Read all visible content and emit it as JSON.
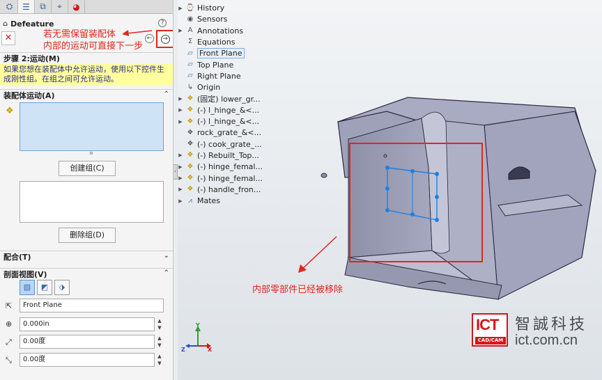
{
  "panel": {
    "tabs": [
      "feature-manager",
      "property-manager",
      "configuration-manager",
      "dimxpert-manager",
      "display-manager"
    ],
    "title": "Defeature",
    "help": "?",
    "close_glyph": "✕",
    "back_glyph": "←",
    "next_glyph": "→",
    "annotation_lines": [
      "若无需保留装配体",
      "内部的运动可直接下一步"
    ],
    "step_heading": "步骤 2:运动(M)",
    "step_message": "如果您想在装配体中允许运动，使用以下控件生成刚性组。在组之间可允许运动。",
    "assembly_motion": {
      "heading": "装配体运动(A)",
      "create_group": "创建组(C)",
      "delete_group": "删除组(D)"
    },
    "mates_heading": "配合(T)",
    "section_view": {
      "heading": "剖面视图(V)",
      "plane": "Front Plane",
      "offset": "0.000in",
      "angle1": "0.00度",
      "angle2": "0.00度"
    }
  },
  "tree": [
    {
      "label": "History",
      "icon": "history-icon",
      "expand": true
    },
    {
      "label": "Sensors",
      "icon": "sensor-icon",
      "expand": false
    },
    {
      "label": "Annotations",
      "icon": "annotation-icon",
      "expand": true
    },
    {
      "label": "Equations",
      "icon": "equation-icon",
      "expand": false
    },
    {
      "label": "Front Plane",
      "icon": "plane-icon",
      "expand": false,
      "highlight": true
    },
    {
      "label": "Top Plane",
      "icon": "plane-icon",
      "expand": false
    },
    {
      "label": "Right Plane",
      "icon": "plane-icon",
      "expand": false
    },
    {
      "label": "Origin",
      "icon": "origin-icon",
      "expand": false
    },
    {
      "label": "(固定) lower_gr...",
      "icon": "part-icon",
      "expand": true
    },
    {
      "label": "(-) l_hinge_&<...",
      "icon": "part-icon",
      "expand": true
    },
    {
      "label": "(-) l_hinge_&<...",
      "icon": "part-icon",
      "expand": true
    },
    {
      "label": "rock_grate_&<...",
      "icon": "part-gray-icon",
      "expand": false
    },
    {
      "label": "(-) cook_grate_...",
      "icon": "part-gray-icon",
      "expand": false
    },
    {
      "label": "(-) Rebuilt_Top...",
      "icon": "part-icon",
      "expand": true
    },
    {
      "label": "(-) hinge_femal...",
      "icon": "part-icon",
      "expand": true
    },
    {
      "label": "(-) hinge_femal...",
      "icon": "part-icon",
      "expand": true
    },
    {
      "label": "(-) handle_fron...",
      "icon": "part-icon",
      "expand": true
    },
    {
      "label": "Mates",
      "icon": "mates-icon",
      "expand": true
    }
  ],
  "annotation_bottom": "内部零部件已经被移除",
  "triad": {
    "x": "X",
    "y": "Y",
    "z": "Z"
  },
  "logo": {
    "mark": "ICT",
    "sub": "CAD/CAM",
    "name": "智誠科技",
    "url": "ict.com.cn"
  },
  "colors": {
    "annotation_red": "#e1261c",
    "message_bg": "#ffff9e",
    "model_fill": "#9a9cb4",
    "selection_blue": "#1f7fe0"
  }
}
